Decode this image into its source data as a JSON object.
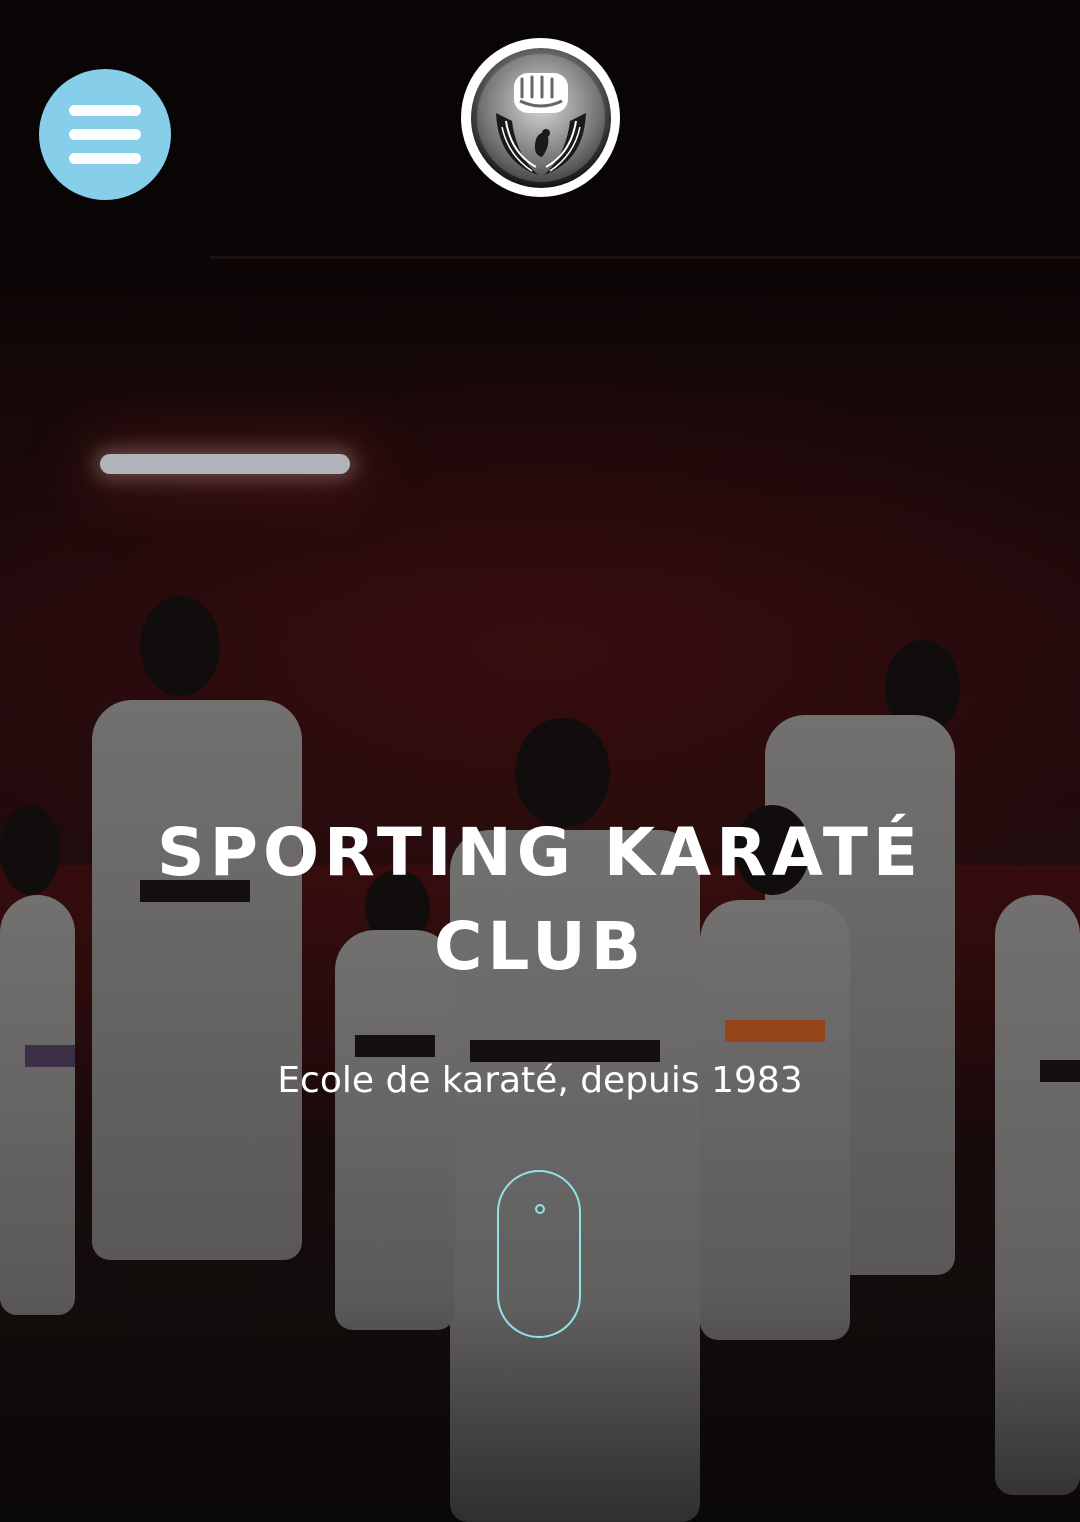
{
  "header": {
    "menu_icon": "hamburger-menu-icon",
    "menu_button_color": "#87ceeb",
    "logo_icon": "fist-and-bird-emblem"
  },
  "hero": {
    "title": "SPORTING KARATÉ CLUB",
    "subtitle": "Ecole de karaté, depuis 1983",
    "scroll_icon": "mouse-scroll-icon",
    "scroll_color": "#8fe3e6",
    "background": "karate class photo, students in white gi viewed from behind"
  }
}
